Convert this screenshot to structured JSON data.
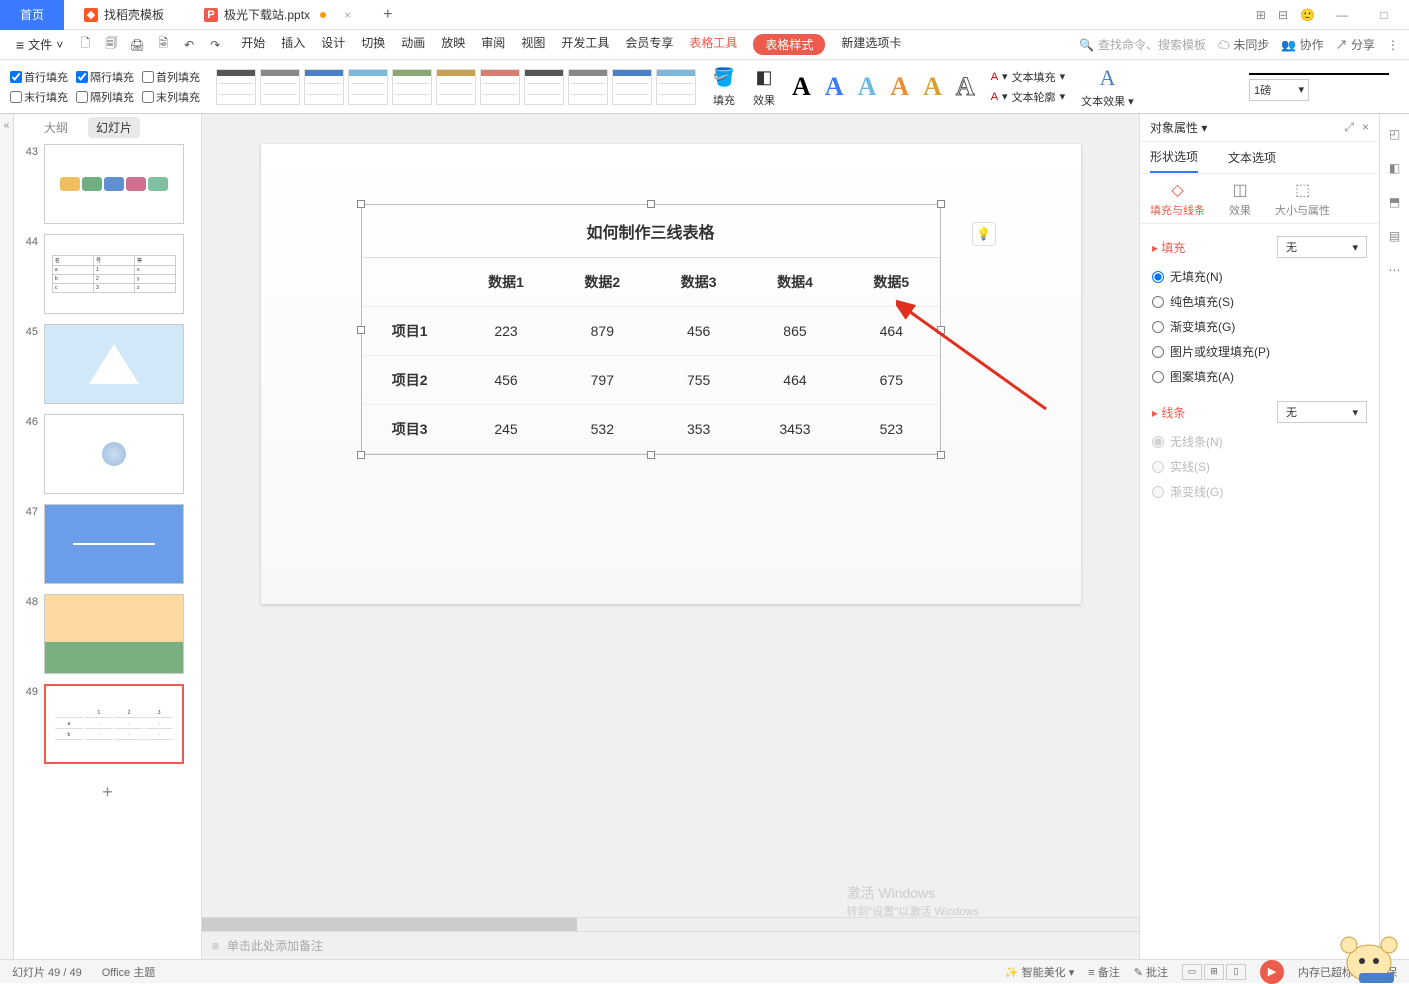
{
  "titlebar": {
    "home": "首页",
    "tab1": "找稻壳模板",
    "tab2": "极光下载站.pptx"
  },
  "menubar": {
    "file": "文件",
    "items": [
      "开始",
      "插入",
      "设计",
      "切换",
      "动画",
      "放映",
      "审阅",
      "视图",
      "开发工具",
      "会员专享"
    ],
    "tool1": "表格工具",
    "tool2": "表格样式",
    "newtab": "新建选项卡",
    "search_placeholder": "查找命令、搜索模板",
    "unsync": "未同步",
    "coop": "协作",
    "share": "分享"
  },
  "ribbon": {
    "checks_row1": [
      "首行填充",
      "隔行填充",
      "首列填充"
    ],
    "checks_row2": [
      "末行填充",
      "隔列填充",
      "末列填充"
    ],
    "fill": "填充",
    "effect": "效果",
    "text_fill": "文本填充",
    "text_outline": "文本轮廓",
    "text_effect": "文本效果",
    "weight": "1磅"
  },
  "slide_tabs": {
    "outline": "大纲",
    "slides": "幻灯片"
  },
  "slides_nums": [
    "43",
    "44",
    "45",
    "46",
    "47",
    "48",
    "49"
  ],
  "slide_table": {
    "title": "如何制作三线表格",
    "headers": [
      "",
      "数据1",
      "数据2",
      "数据3",
      "数据4",
      "数据5"
    ],
    "rows": [
      [
        "项目1",
        "223",
        "879",
        "456",
        "865",
        "464"
      ],
      [
        "项目2",
        "456",
        "797",
        "755",
        "464",
        "675"
      ],
      [
        "项目3",
        "245",
        "532",
        "353",
        "3453",
        "523"
      ]
    ]
  },
  "notes_placeholder": "单击此处添加备注",
  "right_panel": {
    "title": "对象属性",
    "tab_shape": "形状选项",
    "tab_text": "文本选项",
    "sub_fill": "填充与线条",
    "sub_effect": "效果",
    "sub_size": "大小与属性",
    "sec_fill": "填充",
    "sel_none": "无",
    "fill_opts": [
      "无填充(N)",
      "纯色填充(S)",
      "渐变填充(G)",
      "图片或纹理填充(P)",
      "图案填充(A)"
    ],
    "sec_line": "线条",
    "line_opts": [
      "无线条(N)",
      "实线(S)",
      "渐变线(G)"
    ]
  },
  "statusbar": {
    "slide": "幻灯片 49 / 49",
    "theme": "Office 主题",
    "beautify": "智能美化",
    "notes": "备注",
    "comments": "批注",
    "memory": "内存已超标，需要保",
    "activate": "激活 Windows",
    "activate_sub": "转到\"设置\"以激活 Windows"
  }
}
